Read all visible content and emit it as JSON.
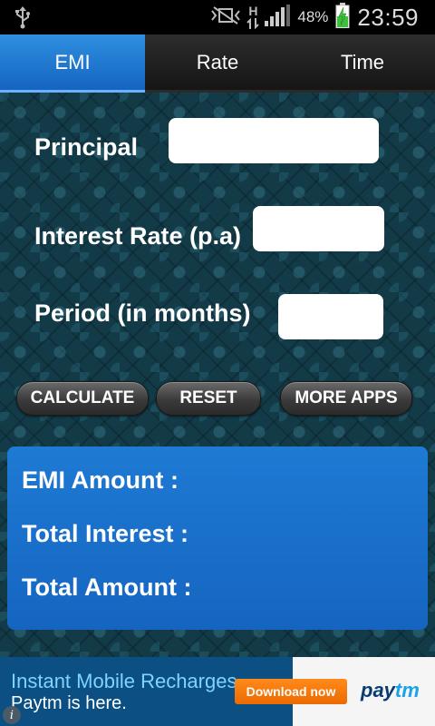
{
  "status_bar": {
    "battery_percent": "48%",
    "time": "23:59",
    "network_type": "H",
    "icons": [
      "usb-icon",
      "mute-vibrate-icon",
      "data-arrows-icon",
      "signal-bars-icon",
      "battery-charging-icon"
    ]
  },
  "tabs": [
    {
      "label": "EMI",
      "active": true
    },
    {
      "label": "Rate",
      "active": false
    },
    {
      "label": "Time",
      "active": false
    }
  ],
  "form": {
    "principal_label": "Principal",
    "principal_value": "",
    "rate_label": "Interest Rate (p.a)",
    "rate_value": "",
    "period_label": "Period (in months)",
    "period_value": ""
  },
  "buttons": {
    "calculate": "CALCULATE",
    "reset": "RESET",
    "more_apps": "MORE APPS"
  },
  "results": {
    "emi_label": "EMI Amount :",
    "interest_label": "Total Interest :",
    "total_label": "Total Amount :"
  },
  "ad": {
    "line1": "Instant Mobile Recharges.",
    "line2": "Paytm is here.",
    "button": "Download now",
    "brand_pay": "pay",
    "brand_tm": "tm"
  },
  "colors": {
    "accent": "#1565c0",
    "tab_active": "#2f8fe0",
    "ad_button": "#ec6a00",
    "brand_dark": "#0b3a70",
    "brand_light": "#1aa3e8"
  }
}
